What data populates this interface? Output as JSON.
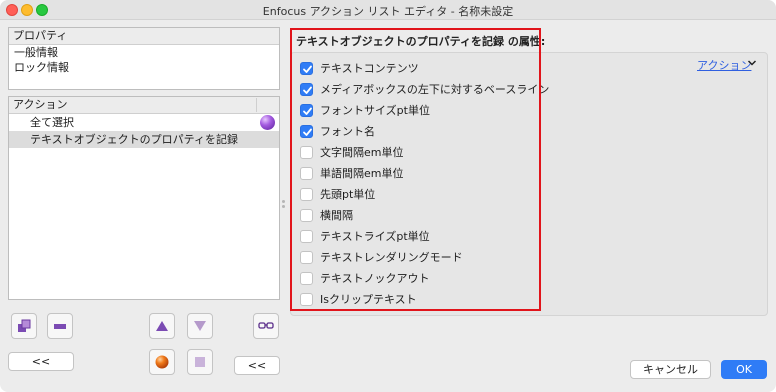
{
  "window": {
    "title": "Enfocus アクション リスト エディタ - 名称未設定"
  },
  "properties": {
    "header": "プロパティ",
    "items": [
      "一般情報",
      "ロック情報"
    ]
  },
  "actions": {
    "header": "アクション",
    "items": [
      {
        "label": "全て選択",
        "selected": false,
        "icon": "purple-ball-icon"
      },
      {
        "label": "テキストオブジェクトのプロパティを記録",
        "selected": true
      }
    ]
  },
  "left_buttons": {
    "collapse_left": "<<",
    "collapse_right": "<<"
  },
  "attributes": {
    "title": "テキストオブジェクトのプロパティを記録 の属性:",
    "action_link": "アクション",
    "options": [
      {
        "label": "テキストコンテンツ",
        "checked": true
      },
      {
        "label": "メディアボックスの左下に対するベースライン",
        "checked": true
      },
      {
        "label": "フォントサイズpt単位",
        "checked": true
      },
      {
        "label": "フォント名",
        "checked": true
      },
      {
        "label": "文字間隔em単位",
        "checked": false
      },
      {
        "label": "単語間隔em単位",
        "checked": false
      },
      {
        "label": "先頭pt単位",
        "checked": false
      },
      {
        "label": "横間隔",
        "checked": false
      },
      {
        "label": "テキストライズpt単位",
        "checked": false
      },
      {
        "label": "テキストレンダリングモード",
        "checked": false
      },
      {
        "label": "テキストノックアウト",
        "checked": false
      },
      {
        "label": "Isクリップテキスト",
        "checked": false
      }
    ]
  },
  "footer": {
    "cancel_label": "キャンセル",
    "ok_label": "OK"
  },
  "colors": {
    "accent": "#2f7cf6",
    "highlight_border": "#e1141b",
    "link": "#2f5fe0"
  }
}
